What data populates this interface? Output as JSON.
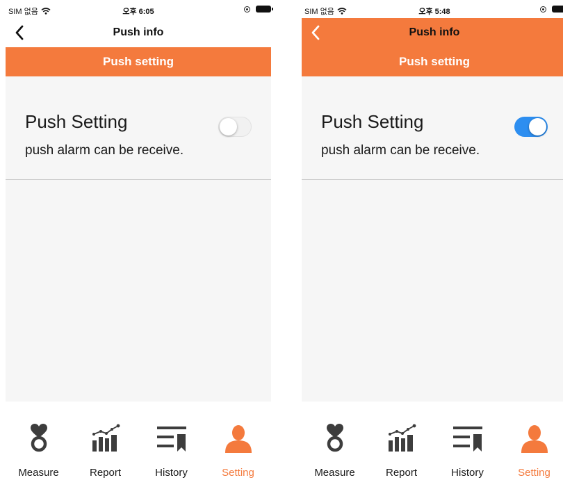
{
  "colors": {
    "accent": "#f47a3d",
    "toggle_on": "#2d8ef0",
    "icon": "#3d3d3d"
  },
  "screens": [
    {
      "status": {
        "carrier": "SIM 없음",
        "time": "오후 6:05"
      },
      "nav": {
        "title": "Push info",
        "back_icon": "chevron-left-icon"
      },
      "section": {
        "title": "Push setting"
      },
      "setting": {
        "title": "Push Setting",
        "description": "push alarm can be receive.",
        "toggle_on": false
      },
      "tabs": [
        {
          "label": "Measure",
          "icon": "heart-ring-icon",
          "active": false
        },
        {
          "label": "Report",
          "icon": "bar-chart-icon",
          "active": false
        },
        {
          "label": "History",
          "icon": "history-list-icon",
          "active": false
        },
        {
          "label": "Setting",
          "icon": "person-icon",
          "active": true
        }
      ]
    },
    {
      "status": {
        "carrier": "SIM 없음",
        "time": "오후 5:48"
      },
      "nav": {
        "title": "Push info",
        "back_icon": "chevron-left-icon"
      },
      "section": {
        "title": "Push setting"
      },
      "setting": {
        "title": "Push Setting",
        "description": "push alarm can be receive.",
        "toggle_on": true
      },
      "tabs": [
        {
          "label": "Measure",
          "icon": "heart-ring-icon",
          "active": false
        },
        {
          "label": "Report",
          "icon": "bar-chart-icon",
          "active": false
        },
        {
          "label": "History",
          "icon": "history-list-icon",
          "active": false
        },
        {
          "label": "Setting",
          "icon": "person-icon",
          "active": true
        }
      ]
    }
  ]
}
